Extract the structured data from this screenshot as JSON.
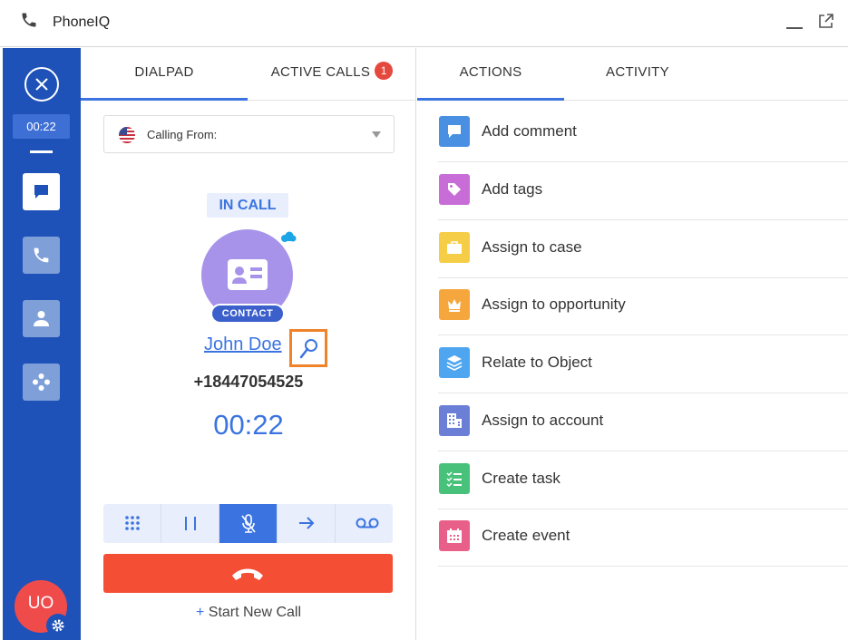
{
  "window": {
    "title": "PhoneIQ"
  },
  "sidebar": {
    "timer": "00:22",
    "items": [
      {
        "name": "chat",
        "icon": "chat-icon",
        "active": true
      },
      {
        "name": "phone",
        "icon": "phone-icon",
        "active": false
      },
      {
        "name": "contacts",
        "icon": "person-icon",
        "active": false
      },
      {
        "name": "integrations",
        "icon": "nodes-icon",
        "active": false
      }
    ],
    "avatar_initials": "UO"
  },
  "left_tabs": [
    {
      "label": "DIALPAD",
      "active": true
    },
    {
      "label": "ACTIVE CALLS",
      "active": false,
      "badge": "1"
    }
  ],
  "calling_from": {
    "label": "Calling From:",
    "value": ""
  },
  "call": {
    "status": "IN CALL",
    "contact_tag": "CONTACT",
    "contact_name": "John Doe",
    "phone_number": "+18447054525",
    "timer": "00:22"
  },
  "controls": [
    {
      "name": "keypad",
      "icon": "keypad-icon",
      "active": false
    },
    {
      "name": "hold",
      "icon": "pause-icon",
      "active": false
    },
    {
      "name": "mute",
      "icon": "mic-off-icon",
      "active": true
    },
    {
      "name": "transfer",
      "icon": "arrow-right-icon",
      "active": false
    },
    {
      "name": "voicemail",
      "icon": "voicemail-icon",
      "active": false
    }
  ],
  "new_call": {
    "plus": "+",
    "label": "Start New Call"
  },
  "right_tabs": [
    {
      "label": "ACTIONS",
      "active": true
    },
    {
      "label": "ACTIVITY",
      "active": false
    }
  ],
  "actions": [
    {
      "label": "Add comment",
      "icon": "comment-icon",
      "color": "#4a90e2"
    },
    {
      "label": "Add tags",
      "icon": "tag-icon",
      "color": "#c86dd7"
    },
    {
      "label": "Assign to case",
      "icon": "briefcase-icon",
      "color": "#f5cd47"
    },
    {
      "label": "Assign to opportunity",
      "icon": "crown-icon",
      "color": "#f5a63d"
    },
    {
      "label": "Relate to Object",
      "icon": "layers-icon",
      "color": "#4ea6f0"
    },
    {
      "label": "Assign to account",
      "icon": "building-icon",
      "color": "#6b7fd7"
    },
    {
      "label": "Create task",
      "icon": "checklist-icon",
      "color": "#48c27a"
    },
    {
      "label": "Create event",
      "icon": "calendar-icon",
      "color": "#e8608a"
    }
  ]
}
